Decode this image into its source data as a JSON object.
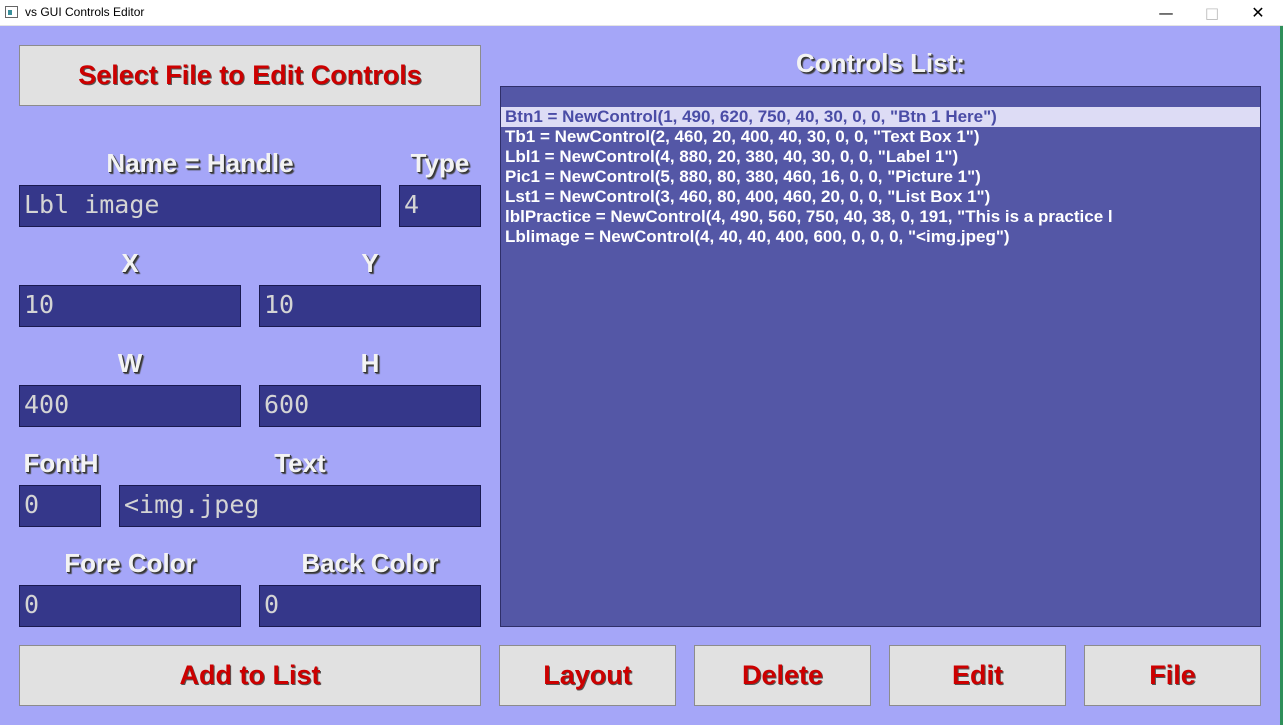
{
  "window": {
    "title": "vs GUI Controls Editor",
    "min_glyph": "—",
    "max_glyph": "□",
    "close_glyph": "✕"
  },
  "select_file_button": "Select File to Edit Controls",
  "form": {
    "name_label": "Name = Handle",
    "type_label": "Type",
    "name_value": "Lbl image",
    "type_value": "4",
    "x_label": "X",
    "y_label": "Y",
    "x_value": "10",
    "y_value": "10",
    "w_label": "W",
    "h_label": "H",
    "w_value": "400",
    "h_value": "600",
    "fonth_label": "FontH",
    "text_label": "Text",
    "fonth_value": "0",
    "text_value": "<img.jpeg",
    "fore_label": "Fore Color",
    "back_label": "Back Color",
    "fore_value": "0",
    "back_value": "0"
  },
  "controls_list": {
    "title": "Controls List:",
    "items": [
      "Btn1 = NewControl(1, 490, 620, 750, 40, 30, 0, 0, \"Btn 1 Here\")",
      "Tb1 = NewControl(2, 460, 20, 400, 40, 30, 0, 0, \"Text Box 1\")",
      "Lbl1 = NewControl(4, 880, 20, 380, 40, 30, 0, 0, \"Label 1\")",
      "Pic1 = NewControl(5, 880, 80, 380, 460, 16, 0, 0, \"Picture 1\")",
      "Lst1 = NewControl(3, 460, 80, 400, 460, 20, 0, 0, \"List Box 1\")",
      "lblPractice = NewControl(4, 490, 560, 750, 40, 38, 0, 191, \"This is a practice l",
      "Lblimage = NewControl(4, 40, 40, 400, 600, 0, 0, 0, \"<img.jpeg\")"
    ],
    "selected_index": 0
  },
  "buttons": {
    "add": "Add to List",
    "layout": "Layout",
    "delete": "Delete",
    "edit": "Edit",
    "file": "File"
  },
  "colors": {
    "background": "#a5a6f8",
    "field": "#35378a",
    "list": "#5457a6",
    "button_text": "#cc0000"
  }
}
